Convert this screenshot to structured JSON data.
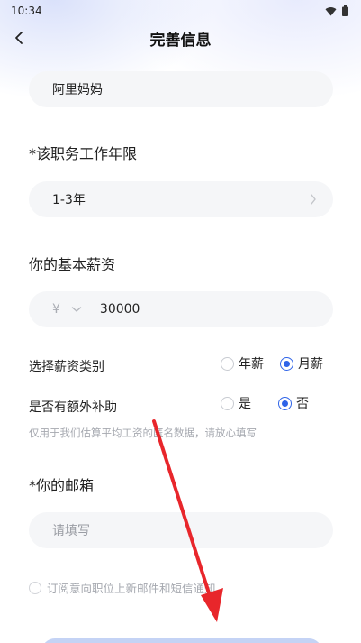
{
  "status": {
    "time": "10:34"
  },
  "header": {
    "title": "完善信息"
  },
  "company": {
    "value": "阿里妈妈"
  },
  "work_years": {
    "label": "*该职务工作年限",
    "value": "1-3年"
  },
  "salary": {
    "label": "你的基本薪资",
    "currency": "¥",
    "value": "30000"
  },
  "salary_type": {
    "label": "选择薪资类别",
    "options": [
      "年薪",
      "月薪"
    ],
    "selected": "月薪"
  },
  "subsidy": {
    "label": "是否有额外补助",
    "options": [
      "是",
      "否"
    ],
    "selected": "否"
  },
  "hint": "仅用于我们估算平均工资的匿名数据，请放心填写",
  "email": {
    "label": "*你的邮箱",
    "placeholder": "请填写"
  },
  "subscribe": {
    "label": "订阅意向职位上新邮件和短信通知"
  },
  "colors": {
    "accent": "#2f64e8",
    "field_bg": "#f5f6f8",
    "arrow": "#e8262b"
  }
}
